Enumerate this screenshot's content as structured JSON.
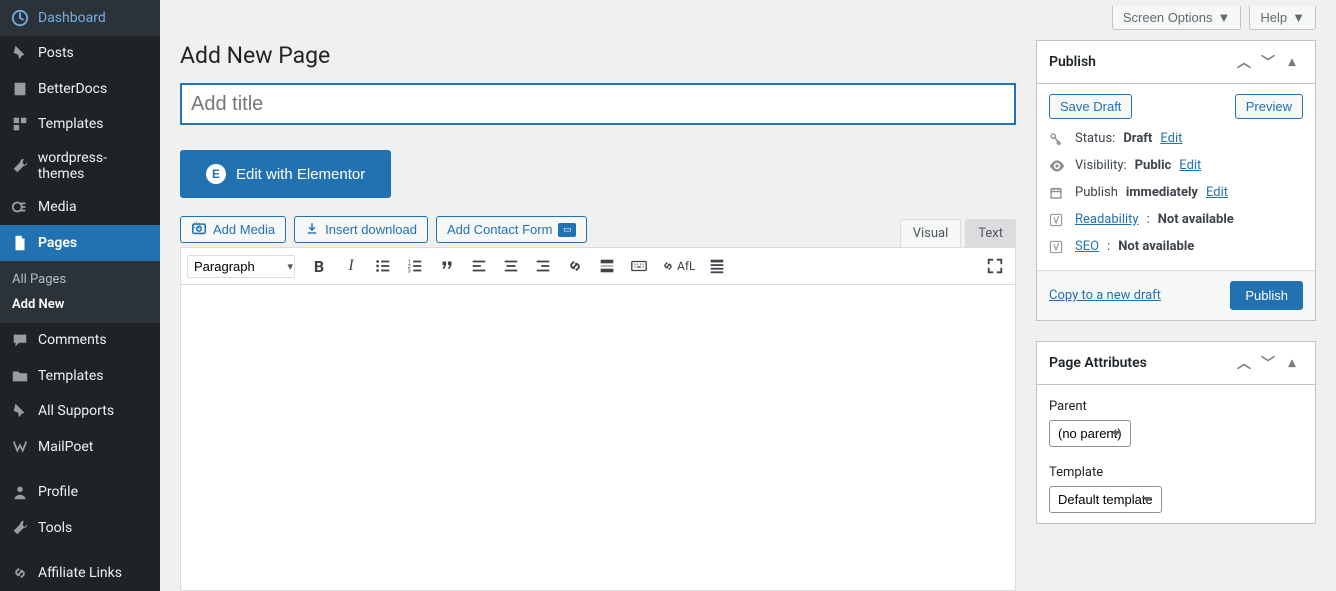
{
  "topbar": {
    "screen_options": "Screen Options",
    "help": "Help"
  },
  "sidebar": {
    "items": [
      {
        "label": "Dashboard"
      },
      {
        "label": "Posts"
      },
      {
        "label": "BetterDocs"
      },
      {
        "label": "Templates"
      },
      {
        "label": "wordpress-themes"
      },
      {
        "label": "Media"
      },
      {
        "label": "Pages"
      },
      {
        "label": "Comments"
      },
      {
        "label": "Templates"
      },
      {
        "label": "All Supports"
      },
      {
        "label": "MailPoet"
      },
      {
        "label": "Profile"
      },
      {
        "label": "Tools"
      },
      {
        "label": "Affiliate Links"
      }
    ],
    "submenu": {
      "all_pages": "All Pages",
      "add_new": "Add New"
    }
  },
  "editor": {
    "heading": "Add New Page",
    "title_placeholder": "Add title",
    "elementor_btn": "Edit with Elementor",
    "add_media": "Add Media",
    "insert_download": "Insert download",
    "add_contact_form": "Add Contact Form",
    "tab_visual": "Visual",
    "tab_text": "Text",
    "format_select": "Paragraph",
    "afl": "AfL"
  },
  "publish": {
    "title": "Publish",
    "save_draft": "Save Draft",
    "preview": "Preview",
    "status_label": "Status:",
    "status_value": "Draft",
    "visibility_label": "Visibility:",
    "visibility_value": "Public",
    "publish_label": "Publish",
    "publish_value": "immediately",
    "edit": "Edit",
    "readability_label": "Readability",
    "not_available": "Not available",
    "seo_label": "SEO",
    "copy_link": "Copy to a new draft",
    "publish_btn": "Publish"
  },
  "attributes": {
    "title": "Page Attributes",
    "parent_label": "Parent",
    "parent_value": "(no parent)",
    "template_label": "Template",
    "template_value": "Default template"
  }
}
